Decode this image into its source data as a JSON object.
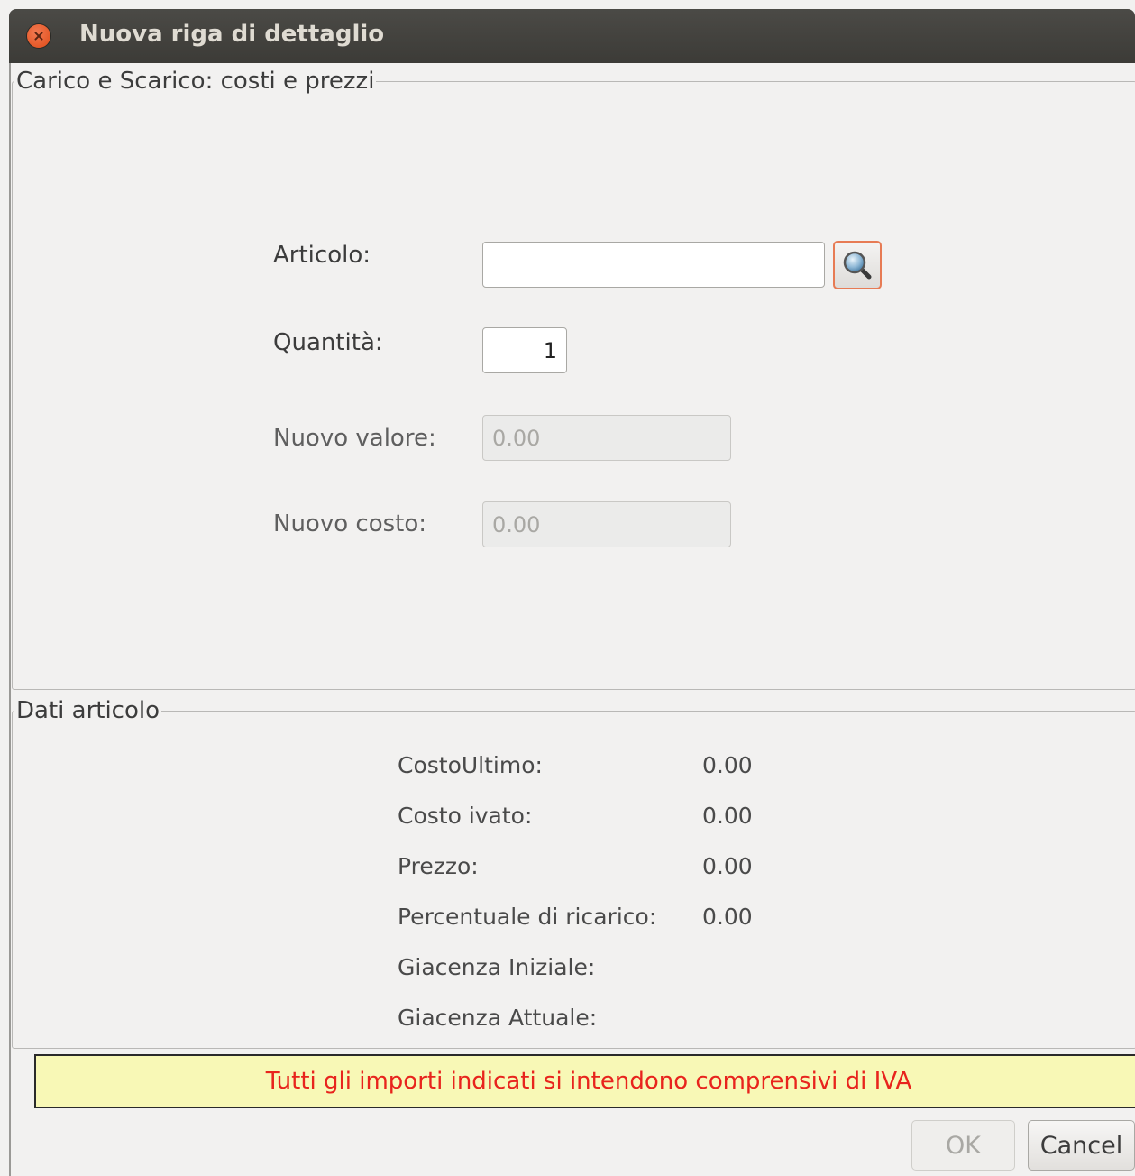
{
  "window": {
    "title": "Nuova riga di dettaglio"
  },
  "section_prices": {
    "legend": "Carico e Scarico: costi e prezzi",
    "articolo": {
      "label": "Articolo:",
      "value": ""
    },
    "quantita": {
      "label": "Quantità:",
      "value": "1"
    },
    "nuovo_valore": {
      "label": "Nuovo valore:",
      "value": "0.00"
    },
    "nuovo_costo": {
      "label": "Nuovo costo:",
      "value": "0.00"
    }
  },
  "section_item": {
    "legend": "Dati articolo",
    "rows": [
      {
        "label": "CostoUltimo:",
        "value": "0.00"
      },
      {
        "label": "Costo ivato:",
        "value": "0.00"
      },
      {
        "label": "Prezzo:",
        "value": "0.00"
      },
      {
        "label": "Percentuale di ricarico:",
        "value": "0.00"
      },
      {
        "label": "Giacenza Iniziale:",
        "value": ""
      },
      {
        "label": "Giacenza Attuale:",
        "value": ""
      }
    ]
  },
  "notice": "Tutti gli importi indicati si intendono comprensivi di IVA",
  "buttons": {
    "ok": "OK",
    "cancel": "Cancel"
  },
  "icons": {
    "close": "close-icon",
    "search": "magnifier-icon"
  },
  "colors": {
    "notice_bg": "#f8f8b6",
    "notice_text": "#e8241d",
    "focus": "#e77b54"
  }
}
